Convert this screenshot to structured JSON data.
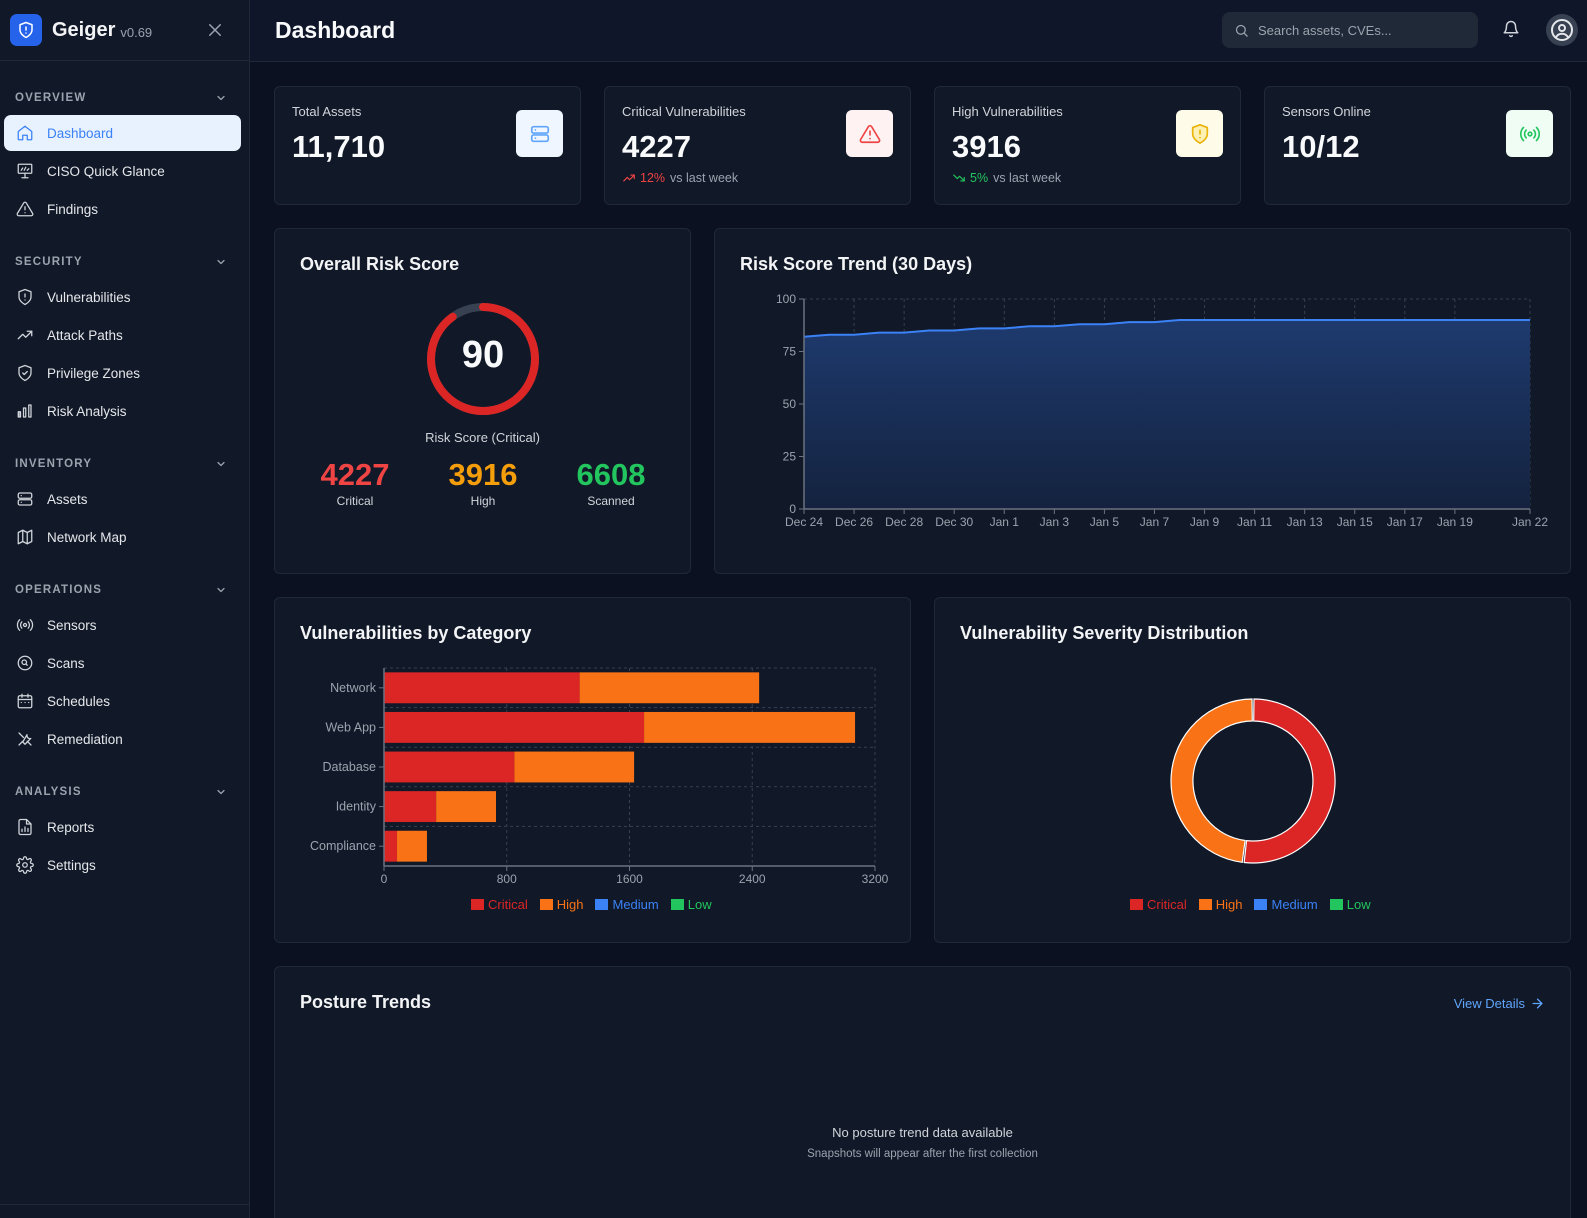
{
  "brand": {
    "name": "Geiger",
    "version": "v0.69"
  },
  "sidebar": {
    "sections": [
      {
        "label": "OVERVIEW",
        "items": [
          {
            "label": "Dashboard",
            "icon": "home-icon",
            "active": true
          },
          {
            "label": "CISO Quick Glance",
            "icon": "presentation-icon"
          },
          {
            "label": "Findings",
            "icon": "alert-triangle-icon"
          }
        ]
      },
      {
        "label": "SECURITY",
        "items": [
          {
            "label": "Vulnerabilities",
            "icon": "shield-alert-icon"
          },
          {
            "label": "Attack Paths",
            "icon": "trending-up-icon"
          },
          {
            "label": "Privilege Zones",
            "icon": "shield-check-icon"
          },
          {
            "label": "Risk Analysis",
            "icon": "bar-chart-icon"
          }
        ]
      },
      {
        "label": "INVENTORY",
        "items": [
          {
            "label": "Assets",
            "icon": "server-icon"
          },
          {
            "label": "Network Map",
            "icon": "map-icon"
          }
        ]
      },
      {
        "label": "OPERATIONS",
        "items": [
          {
            "label": "Sensors",
            "icon": "radio-icon"
          },
          {
            "label": "Scans",
            "icon": "scan-search-icon"
          },
          {
            "label": "Schedules",
            "icon": "calendar-icon"
          },
          {
            "label": "Remediation",
            "icon": "wrench-icon"
          }
        ]
      },
      {
        "label": "ANALYSIS",
        "items": [
          {
            "label": "Reports",
            "icon": "file-chart-icon"
          },
          {
            "label": "Settings",
            "icon": "gear-icon"
          }
        ]
      }
    ]
  },
  "header": {
    "title": "Dashboard",
    "search_placeholder": "Search assets, CVEs..."
  },
  "stats": [
    {
      "label": "Total Assets",
      "value": "11,710",
      "icon": "server-icon",
      "accent": "#60a5fa",
      "bg": "#eff6ff"
    },
    {
      "label": "Critical Vulnerabilities",
      "value": "4227",
      "delta": "12%",
      "delta_text": "vs last week",
      "delta_dir": "up",
      "delta_color": "#ef4444",
      "icon": "alert-triangle-icon",
      "accent": "#ef4444",
      "bg": "#fef2f2"
    },
    {
      "label": "High Vulnerabilities",
      "value": "3916",
      "delta": "5%",
      "delta_text": "vs last week",
      "delta_dir": "down",
      "delta_color": "#22c55e",
      "icon": "shield-alert-icon",
      "accent": "#eab308",
      "bg": "#fefce8"
    },
    {
      "label": "Sensors Online",
      "value": "10/12",
      "icon": "radio-icon",
      "accent": "#22c55e",
      "bg": "#f0fdf4"
    }
  ],
  "risk": {
    "title": "Overall Risk Score",
    "score": "90",
    "score_fraction": 0.9,
    "subtitle": "Risk Score (Critical)",
    "critical": {
      "value": "4227",
      "label": "Critical",
      "color": "#ef4444"
    },
    "high": {
      "value": "3916",
      "label": "High",
      "color": "#f59e0b"
    },
    "scanned": {
      "value": "6608",
      "label": "Scanned",
      "color": "#22c55e"
    }
  },
  "trend": {
    "title": "Risk Score Trend (30 Days)"
  },
  "category": {
    "title": "Vulnerabilities by Category"
  },
  "severity": {
    "title": "Vulnerability Severity Distribution"
  },
  "posture": {
    "title": "Posture Trends",
    "link": "View Details",
    "empty_title": "No posture trend data available",
    "empty_sub": "Snapshots will appear after the first collection"
  },
  "legend": [
    {
      "label": "Critical",
      "color": "#dc2626"
    },
    {
      "label": "High",
      "color": "#f97316"
    },
    {
      "label": "Medium",
      "color": "#3b82f6"
    },
    {
      "label": "Low",
      "color": "#22c55e"
    }
  ],
  "chart_data": [
    {
      "type": "area",
      "title": "Risk Score Trend (30 Days)",
      "x": [
        "Dec 24",
        "Dec 25",
        "Dec 26",
        "Dec 27",
        "Dec 28",
        "Dec 29",
        "Dec 30",
        "Dec 31",
        "Jan 1",
        "Jan 2",
        "Jan 3",
        "Jan 4",
        "Jan 5",
        "Jan 6",
        "Jan 7",
        "Jan 8",
        "Jan 9",
        "Jan 10",
        "Jan 11",
        "Jan 12",
        "Jan 13",
        "Jan 14",
        "Jan 15",
        "Jan 16",
        "Jan 17",
        "Jan 18",
        "Jan 19",
        "Jan 20",
        "Jan 21",
        "Jan 22"
      ],
      "x_ticks": [
        "Dec 24",
        "Dec 26",
        "Dec 28",
        "Dec 30",
        "Jan 1",
        "Jan 3",
        "Jan 5",
        "Jan 7",
        "Jan 9",
        "Jan 11",
        "Jan 13",
        "Jan 15",
        "Jan 17",
        "Jan 19",
        "Jan 22"
      ],
      "series": [
        {
          "values": [
            82,
            83,
            83,
            84,
            84,
            85,
            85,
            86,
            86,
            87,
            87,
            88,
            88,
            89,
            89,
            90,
            90,
            90,
            90,
            90,
            90,
            90,
            90,
            90,
            90,
            90,
            90,
            90,
            90,
            90
          ]
        }
      ],
      "ylim": [
        0,
        100
      ],
      "y_ticks": [
        0,
        25,
        50,
        75,
        100
      ],
      "grid": true,
      "color": "#3b82f6"
    },
    {
      "type": "bar",
      "orientation": "horizontal",
      "stacked": true,
      "title": "Vulnerabilities by Category",
      "categories": [
        "Network",
        "Web App",
        "Database",
        "Identity",
        "Compliance"
      ],
      "series": [
        {
          "name": "Critical",
          "values": [
            1275,
            1695,
            850,
            340,
            85
          ],
          "color": "#dc2626"
        },
        {
          "name": "High",
          "values": [
            1170,
            1375,
            780,
            390,
            195
          ],
          "color": "#f97316"
        },
        {
          "name": "Medium",
          "values": [
            0,
            0,
            0,
            0,
            0
          ],
          "color": "#3b82f6"
        },
        {
          "name": "Low",
          "values": [
            0,
            0,
            0,
            0,
            0
          ],
          "color": "#22c55e"
        }
      ],
      "xlim": [
        0,
        3200
      ],
      "x_ticks": [
        0,
        800,
        1600,
        2400,
        3200
      ],
      "grid": true,
      "legend": "bottom"
    },
    {
      "type": "pie",
      "donut": true,
      "title": "Vulnerability Severity Distribution",
      "labels": [
        "Critical",
        "High",
        "Medium",
        "Low"
      ],
      "values": [
        4227,
        3916,
        0,
        0
      ],
      "colors": [
        "#dc2626",
        "#f97316",
        "#3b82f6",
        "#22c55e"
      ],
      "legend": "bottom"
    }
  ]
}
